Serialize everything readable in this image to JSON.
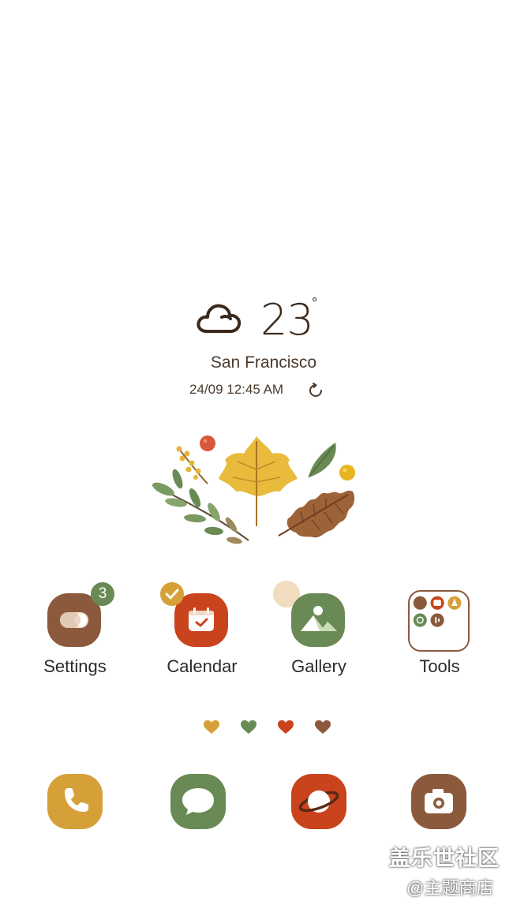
{
  "weather": {
    "temperature": "23",
    "degree_symbol": "°",
    "city": "San Francisco",
    "updated": "24/09 12:45 AM",
    "condition_icon": "cloud-icon"
  },
  "apps": [
    {
      "label": "Settings",
      "icon": "toggle-icon",
      "badge": "3",
      "color": "#8b5a3c"
    },
    {
      "label": "Calendar",
      "icon": "calendar-icon",
      "badge_icon": "check-icon",
      "color": "#c9431c"
    },
    {
      "label": "Gallery",
      "icon": "mountain-icon",
      "color": "#6a8a55"
    },
    {
      "label": "Tools",
      "icon": "folder-icon"
    }
  ],
  "page_indicator": {
    "pages": 4,
    "colors": [
      "#d6a038",
      "#6a8a55",
      "#c9431c",
      "#8b5a3c"
    ]
  },
  "dock": [
    {
      "name": "phone",
      "icon": "phone-icon",
      "color": "#d6a038"
    },
    {
      "name": "messages",
      "icon": "message-icon",
      "color": "#6a8a55"
    },
    {
      "name": "internet",
      "icon": "planet-icon",
      "color": "#c9431c"
    },
    {
      "name": "camera",
      "icon": "camera-icon",
      "color": "#8b5a3c"
    }
  ],
  "watermark": {
    "title": "盖乐世社区",
    "subtitle": "@主题商店"
  }
}
